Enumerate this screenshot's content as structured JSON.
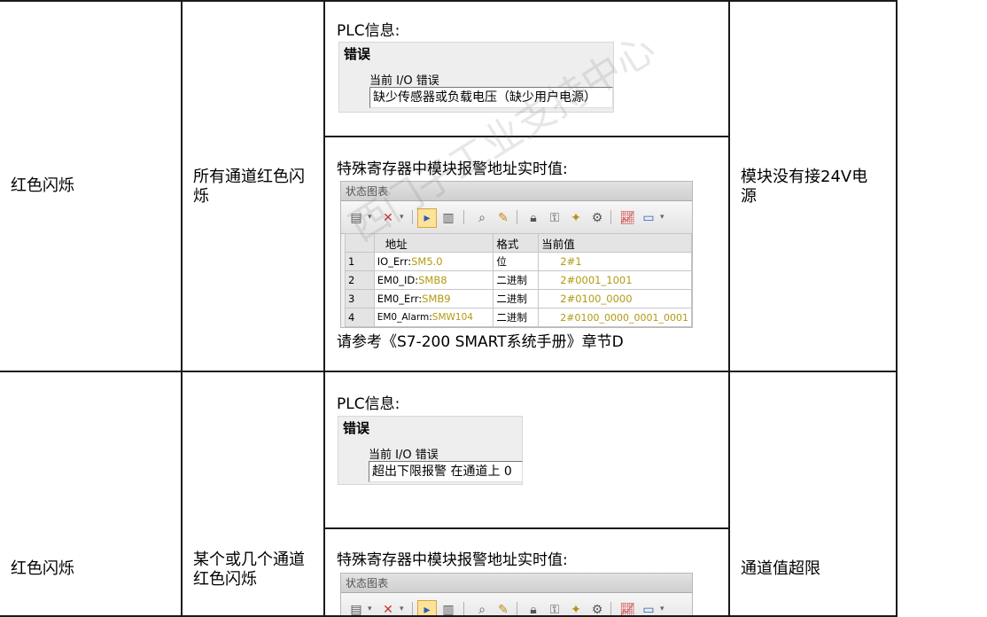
{
  "rows": [
    {
      "led_state": "红色闪烁",
      "description": "所有通道红色闪烁",
      "plc_info": {
        "title": "PLC信息:",
        "panel_heading": "错误",
        "field_label": "当前 I/O 错误",
        "field_value": "缺少传感器或负载电压（缺少用户电源）"
      },
      "special_register": {
        "title": "特殊寄存器中模块报警地址实时值:",
        "chart_title": "状态图表",
        "columns": [
          "地址",
          "格式",
          "当前值"
        ],
        "entries": [
          {
            "index": "1",
            "name": "IO_Err:",
            "address": "SM5.0",
            "format": "位",
            "value": "2#1"
          },
          {
            "index": "2",
            "name": "EM0_ID:",
            "address": "SMB8",
            "format": "二进制",
            "value": "2#0001_1001"
          },
          {
            "index": "3",
            "name": "EM0_Err:",
            "address": "SMB9",
            "format": "二进制",
            "value": "2#0100_0000"
          },
          {
            "index": "4",
            "name": "EM0_Alarm:",
            "address": "SMW104",
            "format": "二进制",
            "value": "2#0100_0000_0001_0001"
          }
        ],
        "reference": "请参考《S7-200 SMART系统手册》章节D"
      },
      "cause": "模块没有接24V电源"
    },
    {
      "led_state": "红色闪烁",
      "description": "某个或几个通道红色闪烁",
      "plc_info": {
        "title": "PLC信息:",
        "panel_heading": "错误",
        "field_label": "当前 I/O 错误",
        "field_value": "超出下限报警 在通道上 0"
      },
      "special_register": {
        "title": "特殊寄存器中模块报警地址实时值:",
        "chart_title": "状态图表"
      },
      "cause": "通道值超限"
    }
  ],
  "watermark": "西门子工业支持中心"
}
